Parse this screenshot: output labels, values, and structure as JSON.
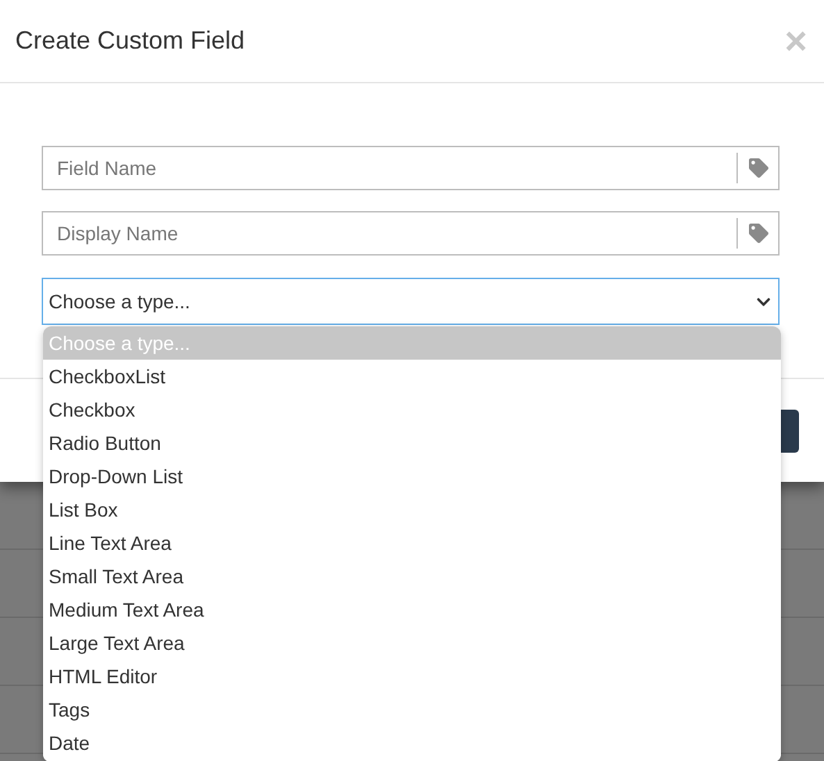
{
  "dialog": {
    "title": "Create Custom Field",
    "close": "×"
  },
  "fields": [
    {
      "placeholder": "Field Name"
    },
    {
      "placeholder": "Display Name"
    }
  ],
  "type_select": {
    "value": "Choose a type...",
    "expanded": true
  },
  "options": [
    {
      "label": "Choose a type...",
      "selected": true
    },
    {
      "label": "CheckboxList",
      "selected": false
    },
    {
      "label": "Checkbox",
      "selected": false
    },
    {
      "label": "Radio Button",
      "selected": false
    },
    {
      "label": "Drop-Down List",
      "selected": false
    },
    {
      "label": "List Box",
      "selected": false
    },
    {
      "label": "Line Text Area",
      "selected": false
    },
    {
      "label": "Small Text Area",
      "selected": false
    },
    {
      "label": "Medium Text Area",
      "selected": false
    },
    {
      "label": "Large Text Area",
      "selected": false
    },
    {
      "label": "HTML Editor",
      "selected": false
    },
    {
      "label": "Tags",
      "selected": false
    },
    {
      "label": "Date",
      "selected": false
    }
  ]
}
